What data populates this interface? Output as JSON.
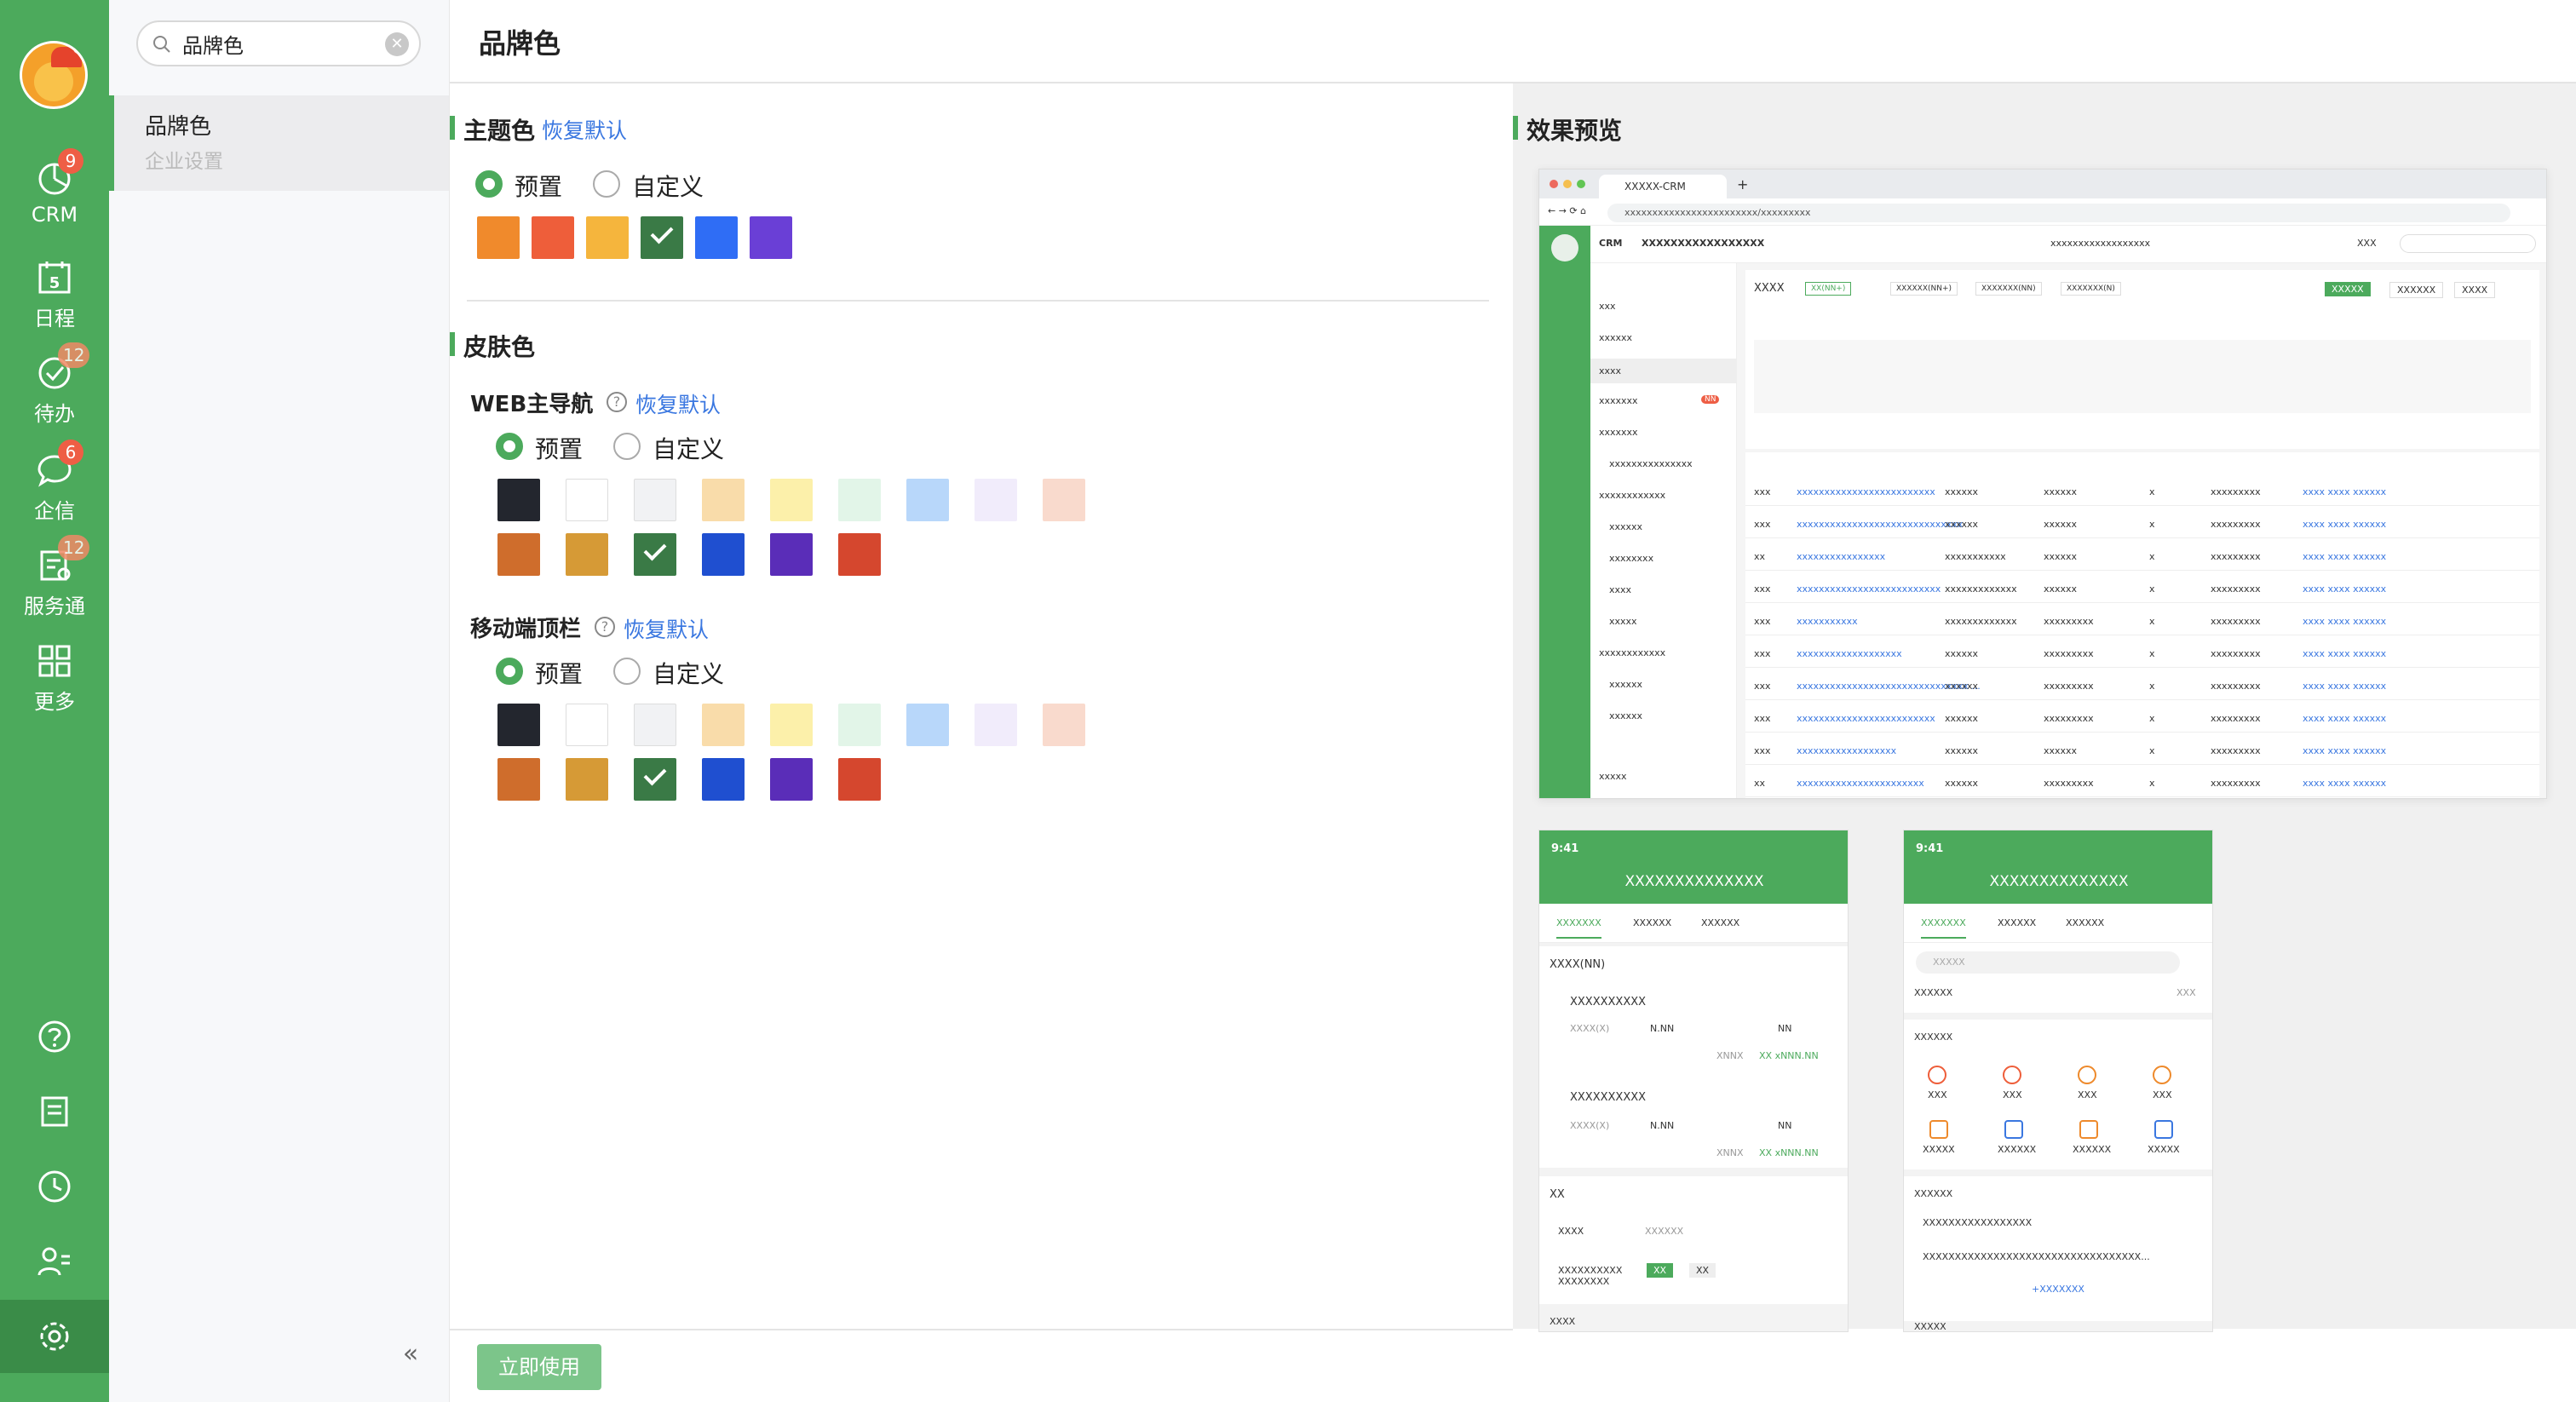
{
  "nav": {
    "items": [
      {
        "label": "CRM",
        "badge": "9",
        "icon": "crm-chart-icon"
      },
      {
        "label": "日程",
        "badge": "",
        "icon": "calendar-icon",
        "day": "5"
      },
      {
        "label": "待办",
        "badge": "12",
        "icon": "check-circle-icon"
      },
      {
        "label": "企信",
        "badge": "6",
        "icon": "chat-bubble-icon"
      },
      {
        "label": "服务通",
        "badge": "12",
        "icon": "service-icon"
      },
      {
        "label": "更多",
        "badge": "",
        "icon": "grid-icon"
      }
    ],
    "bottom": [
      "help-icon",
      "notes-icon",
      "clock-icon",
      "user-list-icon",
      "settings-icon"
    ]
  },
  "side": {
    "search_value": "品牌色",
    "result_title": "品牌色",
    "result_path": "企业设置",
    "collapse": "«"
  },
  "page": {
    "title": "品牌色"
  },
  "theme": {
    "title": "主题色",
    "reset": "恢复默认",
    "options": [
      "预置",
      "自定义"
    ],
    "selected": "预置",
    "colors": [
      "#f08a2c",
      "#ee5e3a",
      "#f5b53d",
      "#3a7a46",
      "#2f6df5",
      "#6a3fd6"
    ],
    "checked_index": 3
  },
  "skin": {
    "title": "皮肤色",
    "web": {
      "title": "WEB主导航",
      "reset": "恢复默认",
      "options": [
        "预置",
        "自定义"
      ],
      "selected": "预置",
      "row1": [
        "#23262e",
        "#ffffff",
        "#f1f2f4",
        "#f9dcaa",
        "#fcf0aa",
        "#e2f5e8",
        "#b8d7fa",
        "#f1ecfb",
        "#f9dacd"
      ],
      "row2": [
        "#cf6d2c",
        "#d69a36",
        "#3a7a46",
        "#1f4fd0",
        "#5a2db8",
        "#d5472e"
      ],
      "checked_row2_index": 2
    },
    "mobile": {
      "title": "移动端顶栏",
      "reset": "恢复默认",
      "options": [
        "预置",
        "自定义"
      ],
      "selected": "预置",
      "row1": [
        "#23262e",
        "#ffffff",
        "#f1f2f4",
        "#f9dcaa",
        "#fcf0aa",
        "#e2f5e8",
        "#b8d7fa",
        "#f1ecfb",
        "#f9dacd"
      ],
      "row2": [
        "#cf6d2c",
        "#d69a36",
        "#3a7a46",
        "#1f4fd0",
        "#5a2db8",
        "#d5472e"
      ],
      "checked_row2_index": 2
    }
  },
  "preview": {
    "title": "效果预览",
    "browser": {
      "tab": "XXXXX-CRM",
      "url": "xxxxxxxxxxxxxxxxxxxxxxxx/xxxxxxxxx",
      "brand": "CRM",
      "company": "XXXXXXXXXXXXXXXXX",
      "center": "xxxxxxxxxxxxxxxxxx",
      "right": "XXX",
      "side_items": [
        "xxx",
        "xxxxxx",
        "xxxx",
        "xxxxxxx",
        "xxxxxxx",
        "xxxxxxxxxxxxxxx",
        "xxxxxxxxxxxx",
        "xxxxxx",
        "xxxxxxxx",
        "xxxx",
        "xxxxx",
        "xxxxxxxxxxxx",
        "xxxxxx",
        "xxxxxx"
      ],
      "side_badge": "NN",
      "side_footer": "xxxxx",
      "header_title": "XXXX",
      "header_tabs": [
        "XX(NN+)",
        "XXXXXX(NN+)",
        "XXXXXXX(NN)",
        "XXXXXXX(N)"
      ],
      "header_btns": [
        "XXXXX",
        "XXXXXX",
        "XXXX"
      ],
      "table_rows": [
        {
          "c1": "xxx",
          "c2": "xxxxxxxxxxxxxxxxxxxxxxxxx",
          "c3": "xxxxxx",
          "c4": "xxxxxx",
          "c5": "x",
          "c6": "xxxxxxxxx"
        },
        {
          "c1": "xxx",
          "c2": "xxxxxxxxxxxxxxxxxxxxxxxxxxxxxx",
          "c3": "xxxxxx",
          "c4": "xxxxxx",
          "c5": "x",
          "c6": "xxxxxxxxx"
        },
        {
          "c1": "xx",
          "c2": "xxxxxxxxxxxxxxxx",
          "c3": "xxxxxxxxxxx",
          "c4": "xxxxxx",
          "c5": "x",
          "c6": "xxxxxxxxx"
        },
        {
          "c1": "xxx",
          "c2": "xxxxxxxxxxxxxxxxxxxxxxxxxx",
          "c3": "xxxxxxxxxxxxx",
          "c4": "xxxxxx",
          "c5": "x",
          "c6": "xxxxxxxxx"
        },
        {
          "c1": "xxx",
          "c2": "xxxxxxxxxxx",
          "c3": "xxxxxxxxxxxxx",
          "c4": "xxxxxxxxx",
          "c5": "x",
          "c6": "xxxxxxxxx"
        },
        {
          "c1": "xxx",
          "c2": "xxxxxxxxxxxxxxxxxxx",
          "c3": "xxxxxx",
          "c4": "xxxxxxxxx",
          "c5": "x",
          "c6": "xxxxxxxxx"
        },
        {
          "c1": "xxx",
          "c2": "xxxxxxxxxxxxxxxxxxxxxxxxxxxxxxx ...",
          "c3": "xxxxxx",
          "c4": "xxxxxxxxx",
          "c5": "x",
          "c6": "xxxxxxxxx"
        },
        {
          "c1": "xxx",
          "c2": "xxxxxxxxxxxxxxxxxxxxxxxxx",
          "c3": "xxxxxx",
          "c4": "xxxxxxxxx",
          "c5": "x",
          "c6": "xxxxxxxxx"
        },
        {
          "c1": "xxx",
          "c2": "xxxxxxxxxxxxxxxxxx",
          "c3": "xxxxxx",
          "c4": "xxxxxx",
          "c5": "x",
          "c6": "xxxxxxxxx"
        },
        {
          "c1": "xx",
          "c2": "xxxxxxxxxxxxxxxxxxxxxxx",
          "c3": "xxxxxx",
          "c4": "xxxxxxxxx",
          "c5": "x",
          "c6": "xxxxxxxxx"
        }
      ],
      "links": "xxxx  xxxx  xxxxxx"
    },
    "phone1": {
      "time": "9:41",
      "title": "XXXXXXXXXXXXXX",
      "tabs": [
        "XXXXXXX",
        "XXXXXX",
        "XXXXXX"
      ],
      "section": "XXXX(NN)",
      "item1": "XXXXXXXXXX",
      "item2": "XXXXXXXXXX",
      "qty_label": "XXXX(X)",
      "price": "N.NN",
      "qty": "NN",
      "sum": "XNNX",
      "total": "XX xNNN.NN",
      "xx": "XX",
      "row": "XXXX",
      "row_val": "XXXXXX",
      "multi": "XXXXXXXXXX XXXXXXXX",
      "footer": "XXXX"
    },
    "phone2": {
      "time": "9:41",
      "title": "XXXXXXXXXXXXXX",
      "tabs": [
        "XXXXXXX",
        "XXXXXX",
        "XXXXXX"
      ],
      "search": "XXXXX",
      "filter": "XXXXXX",
      "cal": "XXX",
      "group": "XXXXXX",
      "apps1": [
        "XXX",
        "XXX",
        "XXX",
        "XXX"
      ],
      "apps2": [
        "XXXXX",
        "XXXXXX",
        "XXXXXX",
        "XXXXX"
      ],
      "list_title": "XXXXXX",
      "list1": "XXXXXXXXXXXXXXXXX",
      "list2": "XXXXXXXXXXXXXXXXXXXXXXXXXXXXXXXXXX...",
      "more": "+XXXXXXX",
      "footer": "XXXXX"
    }
  },
  "footer": {
    "apply": "立即使用"
  }
}
